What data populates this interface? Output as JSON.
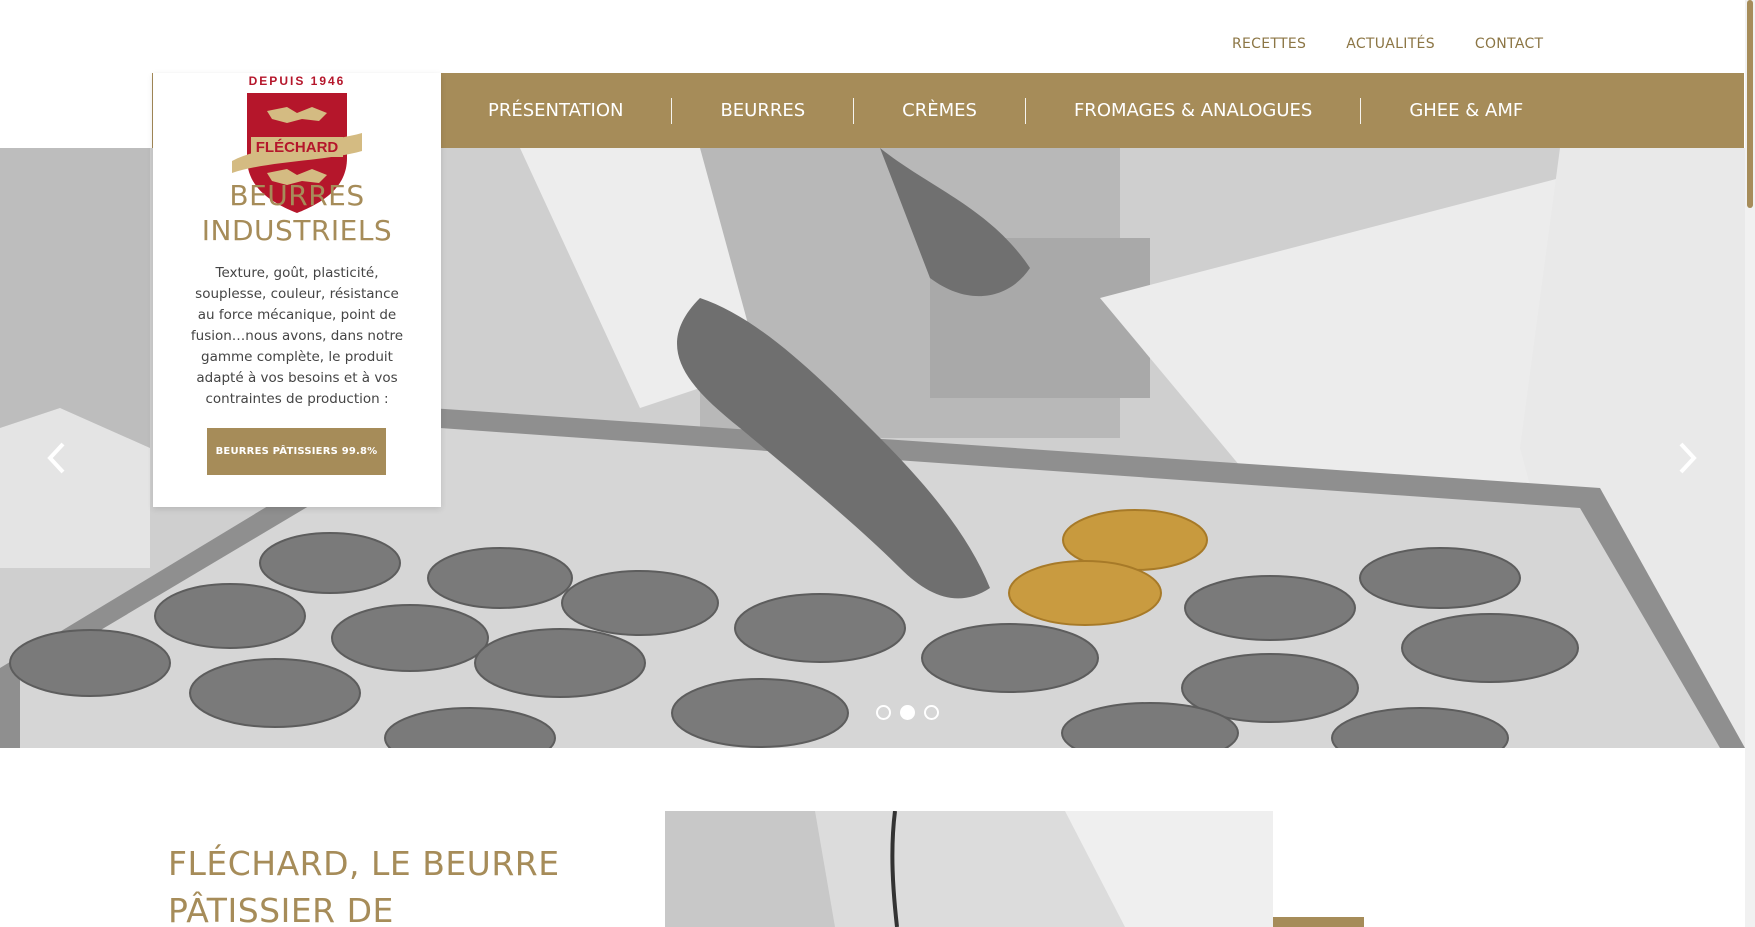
{
  "colors": {
    "accent": "#a68c59",
    "logo_red": "#b5162b"
  },
  "logo": {
    "tagline": "DEPUIS 1946",
    "brand": "FLÉCHARD",
    "icon": "heraldic-shield-lions"
  },
  "top_links": [
    "RECETTES",
    "ACTUALITÉS",
    "CONTACT"
  ],
  "nav": [
    "PRÉSENTATION",
    "BEURRES",
    "CRÈMES",
    "FROMAGES & ANALOGUES",
    "GHEE & AMF"
  ],
  "hero": {
    "title_line1": "BEURRES",
    "title_line2": "INDUSTRIELS",
    "text": "Texture, goût, plasticité, souplesse, couleur, résistance au force mécanique, point de fusion…nous avons, dans notre gamme complète, le produit adapté à vos besoins et à vos contraintes de production :",
    "button": "BEURRES PÂTISSIERS 99.8%",
    "prev_icon": "chevron-left-icon",
    "next_icon": "chevron-right-icon",
    "slides": 3,
    "active_slide": 2
  },
  "section": {
    "title": "FLÉCHARD, LE BEURRE PÂTISSIER DE"
  }
}
